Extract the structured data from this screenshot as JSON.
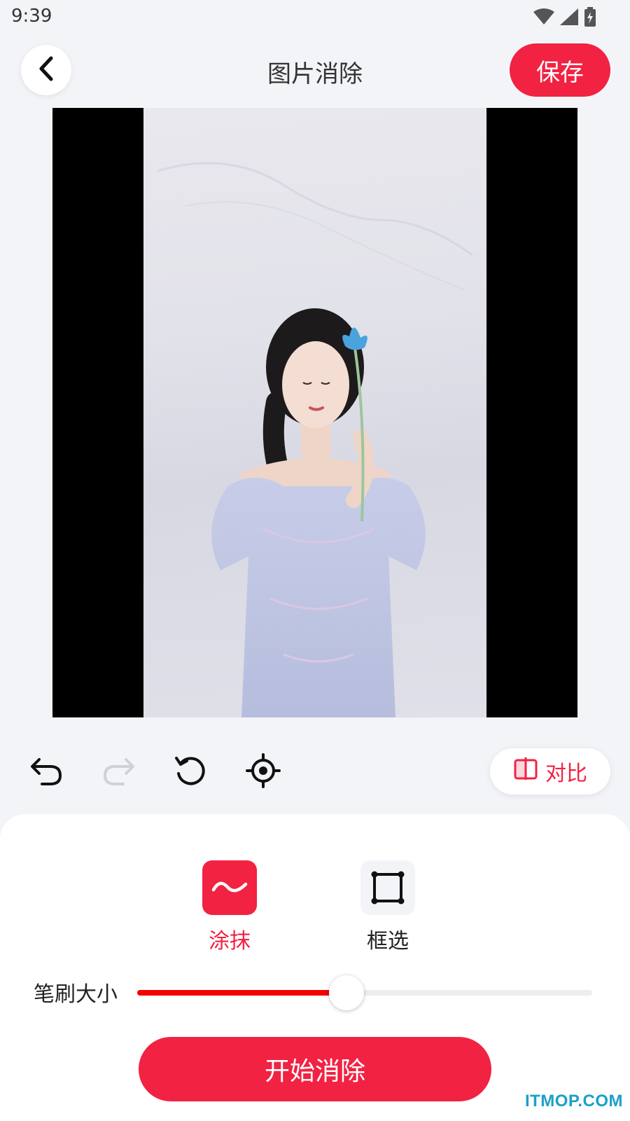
{
  "status_bar": {
    "time": "9:39"
  },
  "header": {
    "title": "图片消除",
    "save_label": "保存"
  },
  "toolbar": {
    "compare_label": "对比"
  },
  "modes": [
    {
      "label": "涂抹",
      "active": true,
      "icon": "smear-wave-icon"
    },
    {
      "label": "框选",
      "active": false,
      "icon": "box-select-icon"
    }
  ],
  "brush": {
    "label": "笔刷大小",
    "value_percent": 46
  },
  "actions": {
    "start_label": "开始消除"
  },
  "watermark": "ITMOP.COM",
  "colors": {
    "accent": "#f22242",
    "slider_fill": "#f40000",
    "background": "#f3f4f8"
  }
}
